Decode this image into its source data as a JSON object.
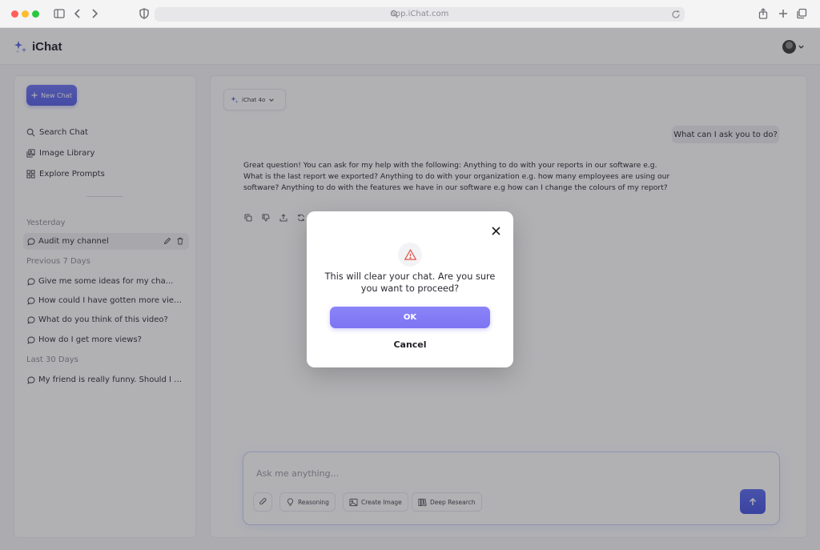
{
  "browser": {
    "url": "app.iChat.com",
    "icons": [
      "sidebar-toggle-icon",
      "back-icon",
      "forward-icon",
      "shield-icon",
      "search-icon",
      "reload-icon",
      "share-icon",
      "new-tab-icon",
      "tabs-icon"
    ]
  },
  "app": {
    "name": "iChat",
    "accent": "#5660e8"
  },
  "sidebar": {
    "new_chat_label": "New Chat",
    "nav": [
      {
        "label": "Search Chat",
        "icon": "search-icon"
      },
      {
        "label": "Image Library",
        "icon": "image-library-icon"
      },
      {
        "label": "Explore Prompts",
        "icon": "grid-icon"
      }
    ],
    "sections": [
      {
        "label": "Yesterday",
        "items": [
          "Audit my channel"
        ]
      },
      {
        "label": "Previous 7 Days",
        "items": [
          "Give me some ideas for my cha...",
          "How could I have gotten more view...",
          "What do you think of this video?",
          "How do I get more views?"
        ]
      },
      {
        "label": "Last 30 Days",
        "items": [
          "My friend is really funny. Should I wi..."
        ]
      }
    ]
  },
  "main": {
    "model_label": "iChat 4o",
    "user_message": "What can I ask you to do?",
    "bot_message": "Great question! You can ask for my help with the following: Anything to do with your reports in our software e.g. What is the last report we exported? Anything to do with your organization e.g. how many employees are using our software? Anything to do with the features we have in our software e.g how can I change the colours of my report?",
    "composer": {
      "placeholder": "Ask me anything...",
      "tools": [
        "Reasoning",
        "Create Image",
        "Deep Research"
      ]
    }
  },
  "modal": {
    "message": "This will clear your chat. Are you sure you want to proceed?",
    "ok_label": "OK",
    "cancel_label": "Cancel",
    "ok_color": "#7d74f3"
  }
}
